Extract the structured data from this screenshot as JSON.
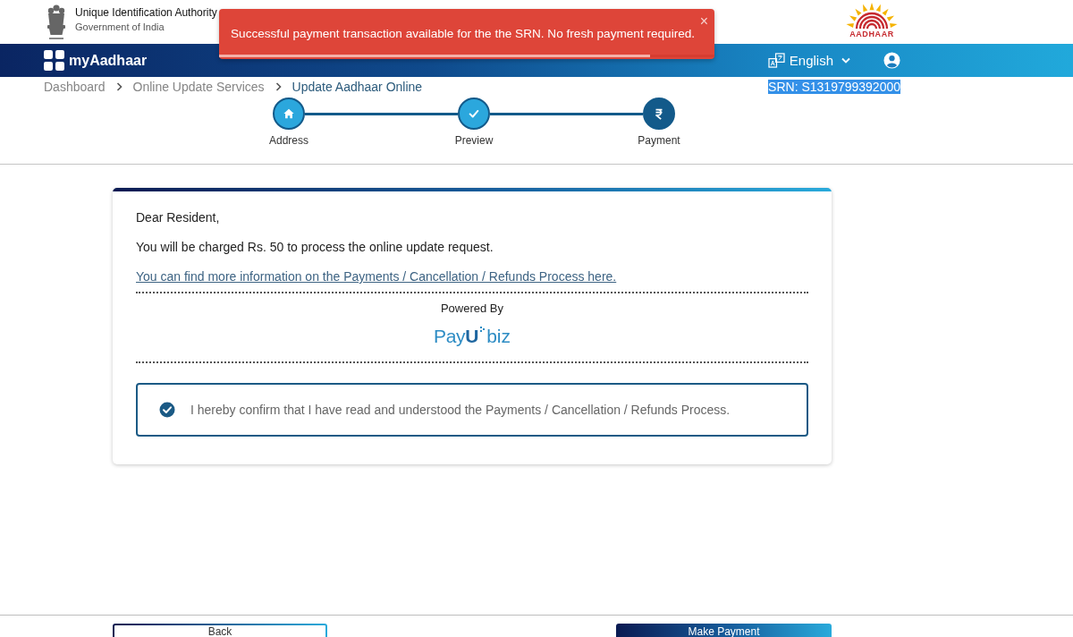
{
  "toast": {
    "message": "Successful payment transaction available for the the SRN. No fresh payment required.",
    "close": "×",
    "level": 0.87
  },
  "header": {
    "org_name": "Unique Identification Authority",
    "org_subtitle": "Government of India",
    "logo_text": "AADHAAR"
  },
  "navbar": {
    "app_name": "myAadhaar",
    "language": "English"
  },
  "breadcrumb": [
    {
      "label": "Dashboard",
      "current": false
    },
    {
      "label": "Online Update Services",
      "current": false
    },
    {
      "label": "Update Aadhaar Online",
      "current": true
    }
  ],
  "srn": {
    "text": "SRN: S1319799392000",
    "highlighted": true
  },
  "steps": [
    {
      "label": "Address",
      "completed": true
    },
    {
      "label": "Preview",
      "completed": true
    },
    {
      "label": "Payment",
      "completed": false
    }
  ],
  "card": {
    "greeting": "Dear Resident,",
    "charge_text": "You will be charged Rs. 50 to process the online update request.",
    "info_link": "You can find more information on the Payments / Cancellation / Refunds Process here.",
    "powered_by": "Powered By",
    "provider_logo": {
      "name": "Pay**U**",
      "suffix": "biz"
    },
    "confirmation": {
      "label": "I hereby confirm that I have read and understood the Payments / Cancellation / Refunds Process.",
      "checked": true
    }
  },
  "footer": {
    "buttons": [
      {
        "label": "Back",
        "kind": "secondary"
      },
      {
        "label": "Make Payment",
        "kind": "primary"
      }
    ]
  }
}
